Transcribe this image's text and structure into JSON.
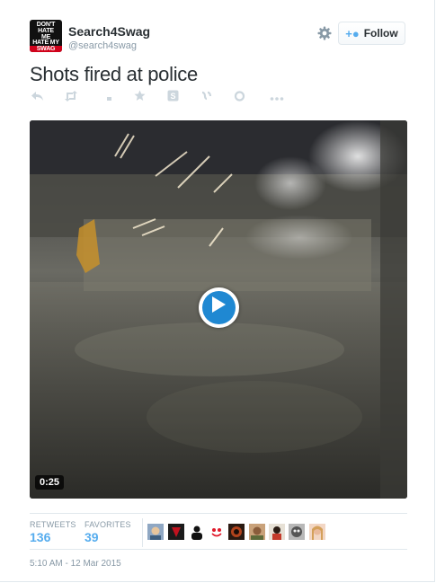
{
  "user": {
    "name": "Search4Swag",
    "handle": "@search4swag",
    "avatar_lines": [
      "DON'T",
      "HATE",
      "ME",
      "HATE MY",
      "SWAG"
    ]
  },
  "follow_button": {
    "label": "Follow",
    "icon": "person-add-icon"
  },
  "tweet": {
    "text": "Shots fired at police"
  },
  "actions": [
    "reply-icon",
    "retweet-icon",
    "delete-icon",
    "favorite-icon",
    "sharing-icon",
    "vine-icon",
    "link-icon",
    "more-icon"
  ],
  "video": {
    "duration": "0:25"
  },
  "stats": {
    "retweets_label": "RETWEETS",
    "retweets_value": "136",
    "favorites_label": "FAVORITES",
    "favorites_value": "39"
  },
  "timestamp": "5:10 AM - 12 Mar 2015",
  "colors": {
    "accent": "#55acee",
    "play": "#1f88d2",
    "muted": "#8899a6"
  }
}
